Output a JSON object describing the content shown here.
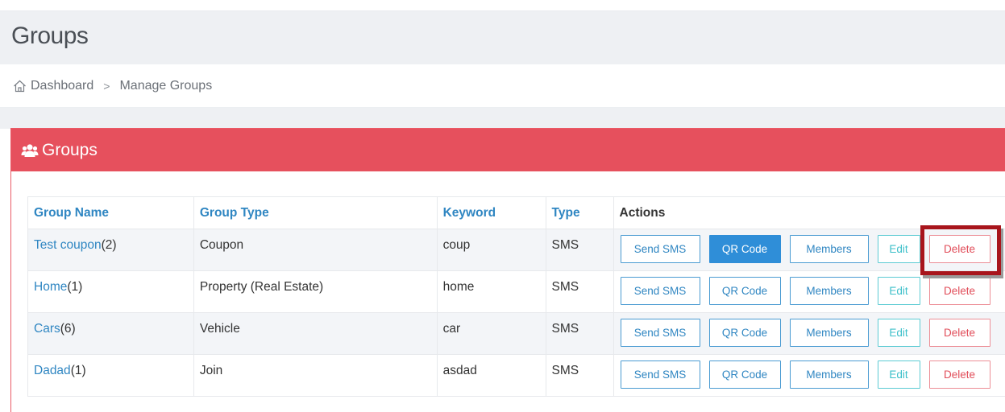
{
  "header": {
    "title": "Groups"
  },
  "breadcrumb": {
    "home_icon": "home-icon",
    "items": [
      "Dashboard",
      "Manage Groups"
    ],
    "separator": ">"
  },
  "panel": {
    "icon": "users-icon",
    "title": "Groups"
  },
  "table": {
    "columns": [
      "Group Name",
      "Group Type",
      "Keyword",
      "Type",
      "Actions"
    ],
    "rows": [
      {
        "name": "Test coupon",
        "count": "(2)",
        "group_type": "Coupon",
        "keyword": "coup",
        "type": "SMS"
      },
      {
        "name": "Home",
        "count": "(1)",
        "group_type": "Property (Real Estate)",
        "keyword": "home",
        "type": "SMS"
      },
      {
        "name": "Cars",
        "count": "(6)",
        "group_type": "Vehicle",
        "keyword": "car",
        "type": "SMS"
      },
      {
        "name": "Dadad",
        "count": "(1)",
        "group_type": "Join",
        "keyword": "asdad",
        "type": "SMS"
      }
    ],
    "actions": {
      "send_sms": "Send SMS",
      "qr_code": "QR Code",
      "members": "Members",
      "edit": "Edit",
      "delete": "Delete"
    }
  },
  "colors": {
    "panel_heading": "#e6505d",
    "link": "#2f86c2",
    "delete": "#e14e5a",
    "edit": "#3bbfc9",
    "qr_active": "#2f8ed8",
    "highlight": "#a8151c"
  }
}
